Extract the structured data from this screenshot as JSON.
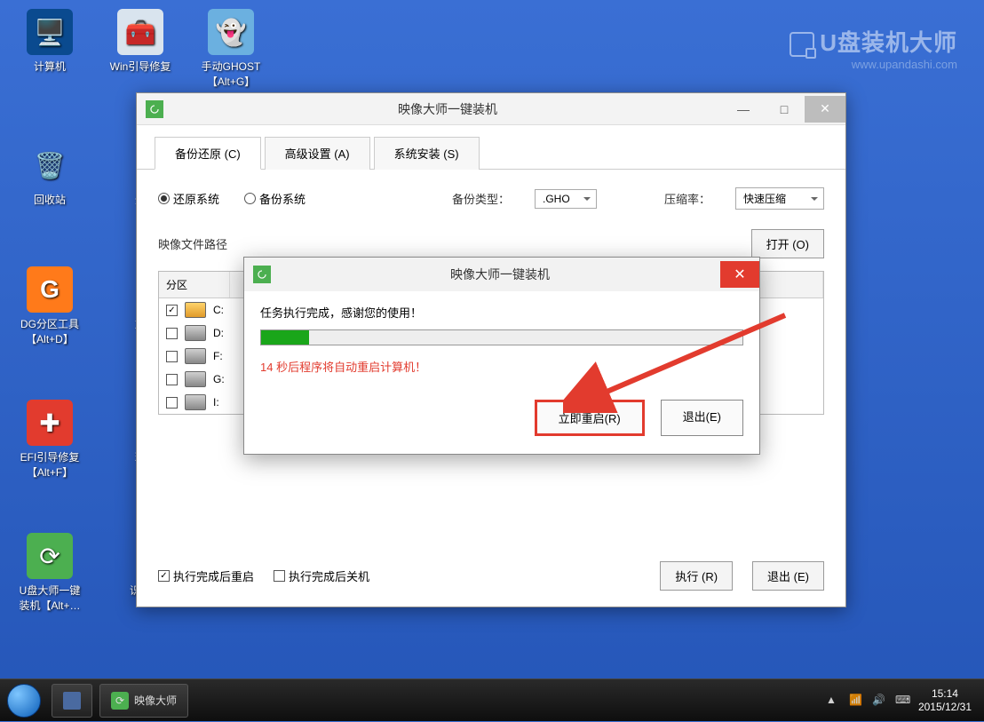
{
  "desktop_icons": [
    {
      "label": "计算机",
      "color": "#0a4a8f",
      "glyph": "🖥"
    },
    {
      "label": "Win引导修复",
      "color": "#d9e4ee",
      "glyph": "🧰"
    },
    {
      "label": "手动GHOST\n【Alt+G】",
      "color": "#9be0ff",
      "glyph": "👻"
    },
    {
      "label": "回收站",
      "color": "#2a4a7a",
      "glyph": "🗑"
    },
    {
      "label": "登",
      "color": "#2a4a7a",
      "glyph": ""
    },
    {
      "label": "DG分区工具\n【Alt+D】",
      "color": "#ff7a1a",
      "glyph": "G"
    },
    {
      "label": "加",
      "color": "#2a4a7a",
      "glyph": ""
    },
    {
      "label": "EFI引导修复\n【Alt+F】",
      "color": "#e23b2e",
      "glyph": "✚"
    },
    {
      "label": "理",
      "color": "#2a4a7a",
      "glyph": ""
    },
    {
      "label": "U盘大师一键\n装机【Alt+…",
      "color": "#4caf50",
      "glyph": "⟳"
    },
    {
      "label": "识…",
      "color": "#2a4a7a",
      "glyph": ""
    }
  ],
  "watermark": {
    "title": "U盘装机大师",
    "url": "www.upandashi.com"
  },
  "main": {
    "title": "映像大师一键装机",
    "tabs": [
      "备份还原 (C)",
      "高级设置 (A)",
      "系统安装 (S)"
    ],
    "radio_restore": "还原系统",
    "radio_backup": "备份系统",
    "backup_type_label": "备份类型：",
    "backup_type_value": ".GHO",
    "compress_label": "压缩率：",
    "compress_value": "快速压缩",
    "path_label": "映像文件路径",
    "open_btn": "打开 (O)",
    "table_header": "分区",
    "drives": [
      {
        "letter": "C:",
        "checked": true
      },
      {
        "letter": "D:",
        "checked": false
      },
      {
        "letter": "F:",
        "checked": false
      },
      {
        "letter": "G:",
        "checked": false
      },
      {
        "letter": "I:",
        "checked": false
      }
    ],
    "chk_restart": "执行完成后重启",
    "chk_shutdown": "执行完成后关机",
    "exec_btn": "执行 (R)",
    "exit_btn": "退出 (E)"
  },
  "dialog": {
    "title": "映像大师一键装机",
    "done_msg": "任务执行完成，感谢您的使用！",
    "countdown": "14 秒后程序将自动重启计算机！",
    "restart_btn": "立即重启(R)",
    "exit_btn": "退出(E)"
  },
  "taskbar": {
    "app": "映像大师",
    "time": "15:14",
    "date": "2015/12/31"
  }
}
